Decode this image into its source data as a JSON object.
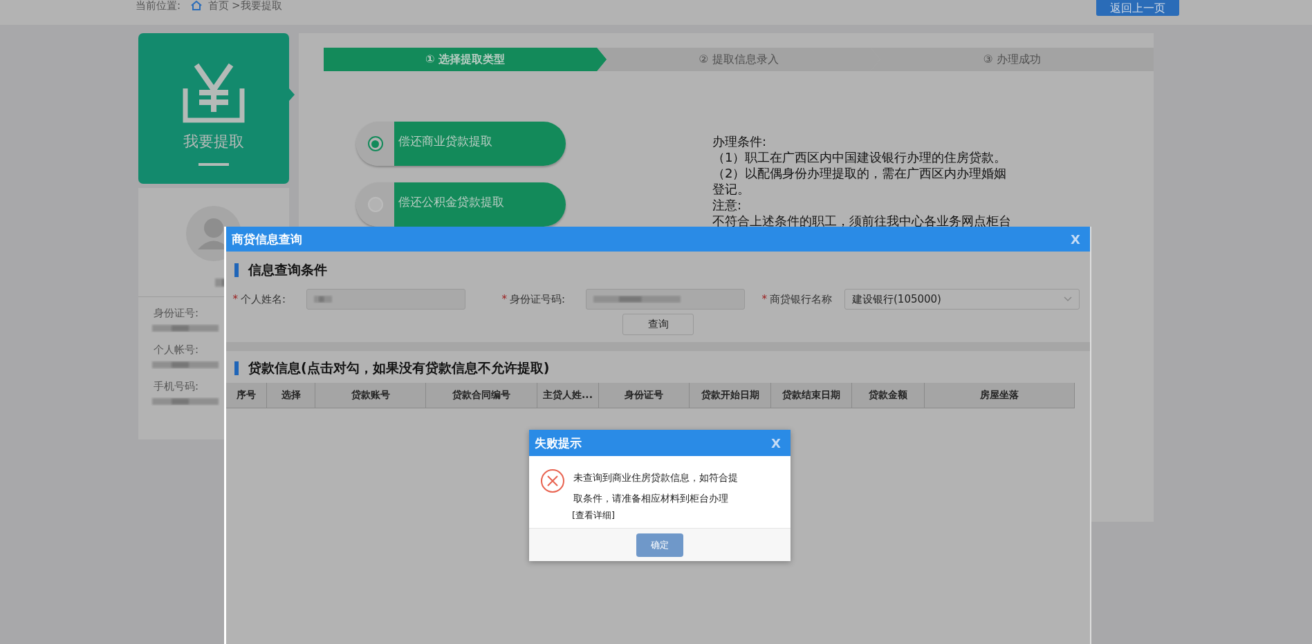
{
  "breadcrumb": {
    "label": "当前位置:",
    "home": "首页",
    "current": ">我要提取"
  },
  "back_button": "返回上一页",
  "sidebar": {
    "title": "我要提取",
    "fields": [
      {
        "label": "身份证号:"
      },
      {
        "label": "个人帐号:"
      },
      {
        "label": "手机号码:"
      }
    ]
  },
  "steps": [
    {
      "label": "① 选择提取类型",
      "selected": true
    },
    {
      "label": "② 提取信息录入",
      "selected": false
    },
    {
      "label": "③ 办理成功",
      "selected": false
    }
  ],
  "options": [
    {
      "label": "偿还商业贷款提取",
      "selected": true
    },
    {
      "label": "偿还公积金贷款提取",
      "selected": false
    }
  ],
  "conditions": [
    "办理条件:",
    "（1）职工在广西区内中国建设银行办理的住房贷款。",
    "（2）以配偶身份办理提取的，需在广西区内办理婚姻登记。",
    "注意:",
    "不符合上述条件的职工，须前往我中心各业务网点柜台"
  ],
  "dialog": {
    "title": "商贷信息查询",
    "close": "X",
    "query_section": "信息查询条件",
    "fields": [
      {
        "mark": "*",
        "label": "个人姓名:",
        "kind": "input"
      },
      {
        "mark": "*",
        "label": "身份证号码:",
        "kind": "input"
      },
      {
        "mark": "*",
        "label": "商贷银行名称",
        "kind": "select",
        "value": "建设银行(105000)"
      }
    ],
    "query_button": "查询",
    "loan_section": "贷款信息(点击对勾，如果没有贷款信息不允许提取)",
    "columns": [
      "序号",
      "选择",
      "贷款账号",
      "贷款合同编号",
      "主贷人姓...",
      "身份证号",
      "贷款开始日期",
      "贷款结束日期",
      "贷款金额",
      "房屋坐落"
    ]
  },
  "alert": {
    "title": "失败提示",
    "close": "X",
    "message": "未查询到商业住房贷款信息，如符合提取条件，请准备相应材料到柜台办理",
    "link": "[查看详细]",
    "button": "确定"
  }
}
